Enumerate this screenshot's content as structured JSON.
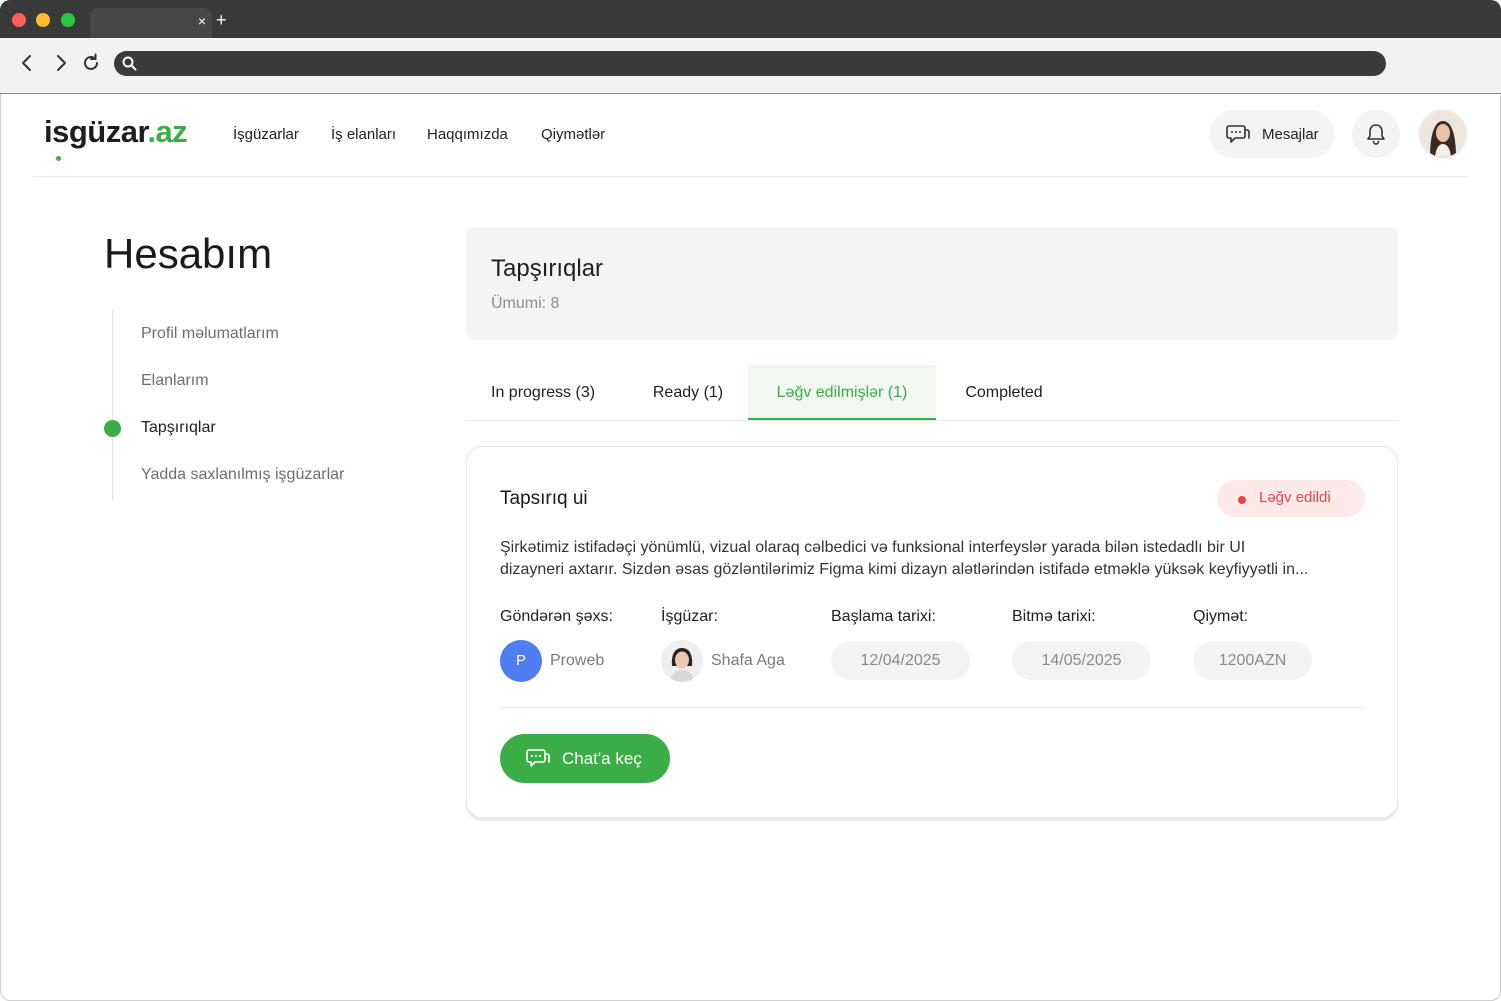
{
  "browser": {
    "tab_close": "×",
    "tab_new": "+"
  },
  "header": {
    "logo_main": "isgüzar",
    "logo_accent": ".az",
    "nav": [
      "İşgüzarlar",
      "İş elanları",
      "Haqqımızda",
      "Qiymətlər"
    ],
    "messages_label": "Mesajlar"
  },
  "sidebar": {
    "title": "Hesabım",
    "items": [
      {
        "label": "Profil məlumatlarım",
        "active": false
      },
      {
        "label": "Elanlarım",
        "active": false
      },
      {
        "label": "Tapşırıqlar",
        "active": true
      },
      {
        "label": "Yadda saxlanılmış işgüzarlar",
        "active": false
      }
    ]
  },
  "panel": {
    "title": "Tapşırıqlar",
    "total": "Ümumi: 8"
  },
  "tabs": [
    {
      "label": "In progress (3)",
      "active": false
    },
    {
      "label": "Ready (1)",
      "active": false
    },
    {
      "label": "Ləğv edilmişlər (1)",
      "active": true
    },
    {
      "label": "Completed",
      "active": false
    }
  ],
  "task": {
    "title": "Tapsırıq ui",
    "status": "Ləğv edildi",
    "description_line1": "Şirkətimiz istifadəçi yönümlü, vizual olaraq cəlbedici və funksional interfeyslər yarada bilən istedadlı bir UI",
    "description_line2": "dizayneri axtarır. Sizdən əsas gözləntilərimiz Figma kimi dizayn alətlərindən istifadə etməklə yüksək keyfiyyətli in...",
    "sender_label": "Göndərən şəxs:",
    "sender_initial": "P",
    "sender_name": "Proweb",
    "worker_label": "İşgüzar:",
    "worker_name": "Shafa Aga",
    "start_label": "Başlama tarixi:",
    "start_date": "12/04/2025",
    "end_label": "Bitmə tarixi:",
    "end_date": "14/05/2025",
    "price_label": "Qiymət:",
    "price": "1200AZN",
    "chat_button": "Chat'a keç"
  },
  "colors": {
    "accent": "#3bad46",
    "danger": "#e64545",
    "sender_avatar": "#4f7df2"
  }
}
